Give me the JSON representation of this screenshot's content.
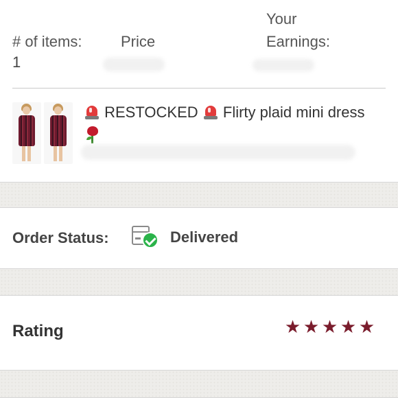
{
  "summary": {
    "items_label": "# of items:",
    "price_label": "Price",
    "earnings_label": "Your Earnings:",
    "items_value": "1"
  },
  "listing": {
    "title_part1": "RESTOCKED",
    "title_part2": "Flirty plaid mini dress",
    "icons": [
      "police-siren-icon",
      "police-siren-icon",
      "rose-icon"
    ]
  },
  "order_status": {
    "label": "Order Status:",
    "value": "Delivered",
    "icon": "delivered-box-check-icon"
  },
  "rating": {
    "label": "Rating",
    "stars": 5,
    "max_stars": 5,
    "star_glyph": "★",
    "star_color": "#7a1c2c"
  },
  "colors": {
    "status_check": "#2bb34a",
    "text": "#333333"
  }
}
